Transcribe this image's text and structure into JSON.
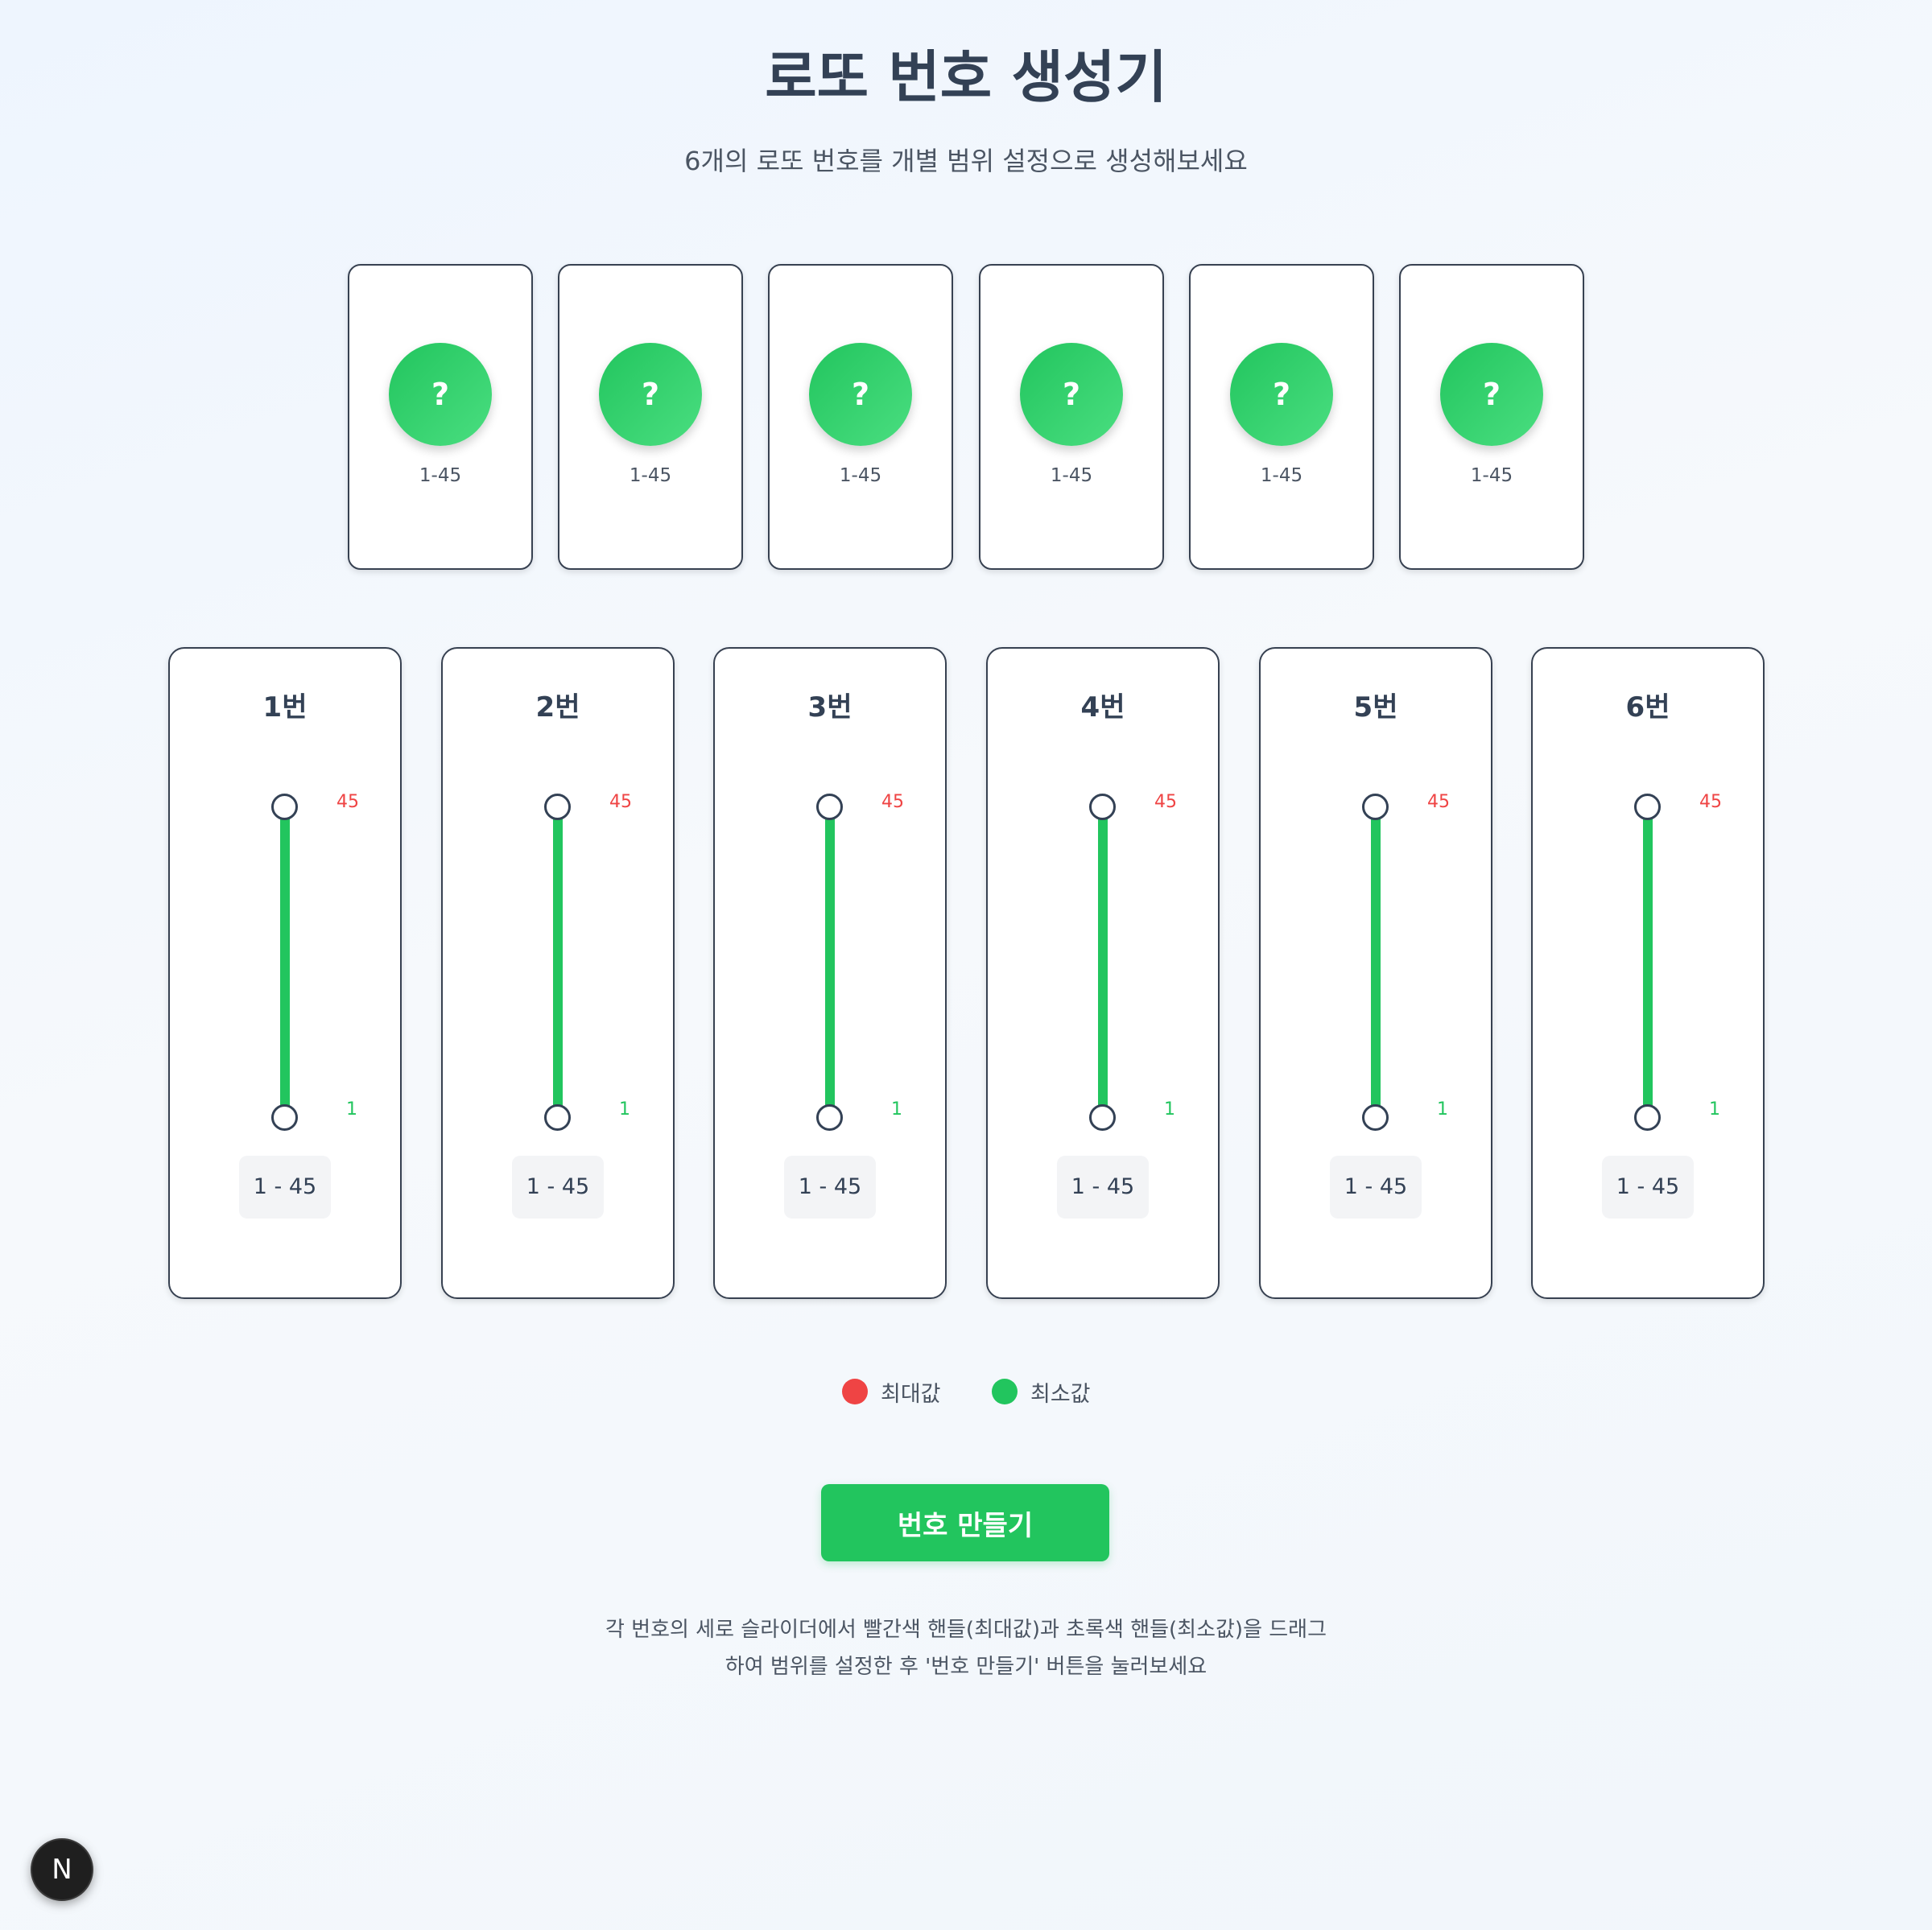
{
  "header": {
    "title": "로또 번호 생성기",
    "subtitle": "6개의 로또 번호를 개별 범위 설정으로 생성해보세요"
  },
  "balls": [
    {
      "value": "?",
      "range": "1-45"
    },
    {
      "value": "?",
      "range": "1-45"
    },
    {
      "value": "?",
      "range": "1-45"
    },
    {
      "value": "?",
      "range": "1-45"
    },
    {
      "value": "?",
      "range": "1-45"
    },
    {
      "value": "?",
      "range": "1-45"
    }
  ],
  "sliders": [
    {
      "label": "1번",
      "max": "45",
      "min": "1",
      "range": "1 - 45"
    },
    {
      "label": "2번",
      "max": "45",
      "min": "1",
      "range": "1 - 45"
    },
    {
      "label": "3번",
      "max": "45",
      "min": "1",
      "range": "1 - 45"
    },
    {
      "label": "4번",
      "max": "45",
      "min": "1",
      "range": "1 - 45"
    },
    {
      "label": "5번",
      "max": "45",
      "min": "1",
      "range": "1 - 45"
    },
    {
      "label": "6번",
      "max": "45",
      "min": "1",
      "range": "1 - 45"
    }
  ],
  "legend": {
    "max_label": "최대값",
    "min_label": "최소값",
    "max_color": "#ef4444",
    "min_color": "#22c55e"
  },
  "actions": {
    "create_label": "번호 만들기"
  },
  "help": {
    "line1": "각 번호의 세로 슬라이더에서 빨간색 핸들(최대값)과 초록색 핸들(최소값)을 드래그",
    "line2": "하여 범위를 설정한 후 '번호 만들기' 버튼을 눌러보세요"
  },
  "colors": {
    "accent": "#22c55e",
    "max": "#ef4444",
    "text": "#334155"
  },
  "badge": {
    "letter": "N",
    "icon": "nextjs-logo-icon"
  }
}
